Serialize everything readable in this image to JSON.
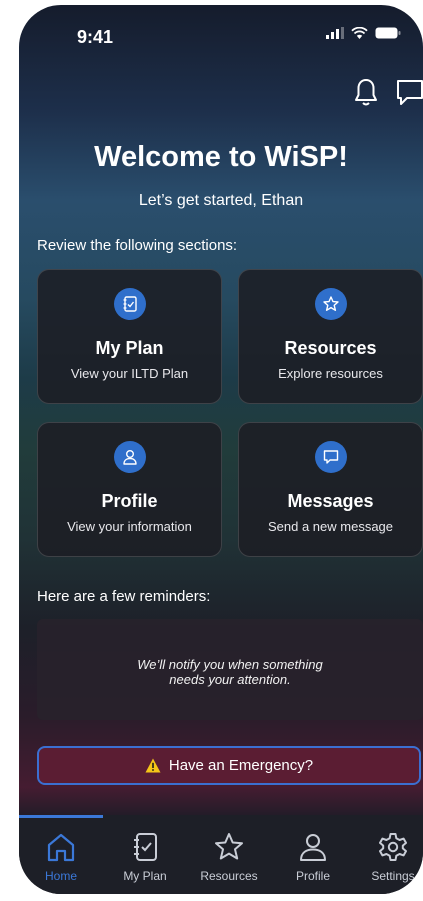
{
  "status_bar": {
    "time": "9:41"
  },
  "header": {
    "title": "Welcome to WiSP!",
    "subtitle": "Let’s get started, Ethan",
    "section_prompt": "Review the following sections:"
  },
  "cards": [
    {
      "title": "My Plan",
      "subtitle": "View your ILTD Plan",
      "icon": "plan-icon"
    },
    {
      "title": "Resources",
      "subtitle": "Explore resources",
      "icon": "star-icon"
    },
    {
      "title": "Profile",
      "subtitle": "View your information",
      "icon": "person-icon"
    },
    {
      "title": "Messages",
      "subtitle": "Send a new message",
      "icon": "message-icon"
    }
  ],
  "reminders": {
    "label": "Here are a few reminders:",
    "empty_text_line1": "We’ll notify you when something",
    "empty_text_line2": "needs your attention."
  },
  "emergency": {
    "label": "Have an Emergency?"
  },
  "tabs": [
    {
      "label": "Home",
      "icon": "home-icon",
      "active": true
    },
    {
      "label": "My Plan",
      "icon": "plan-icon"
    },
    {
      "label": "Resources",
      "icon": "star-icon"
    },
    {
      "label": "Profile",
      "icon": "person-icon"
    },
    {
      "label": "Settings",
      "icon": "gear-icon"
    }
  ],
  "colors": {
    "accent": "#3b78d8",
    "icon_circle": "#2f6fcb",
    "emergency_bg": "#5b1d33",
    "warning": "#f5c518"
  }
}
